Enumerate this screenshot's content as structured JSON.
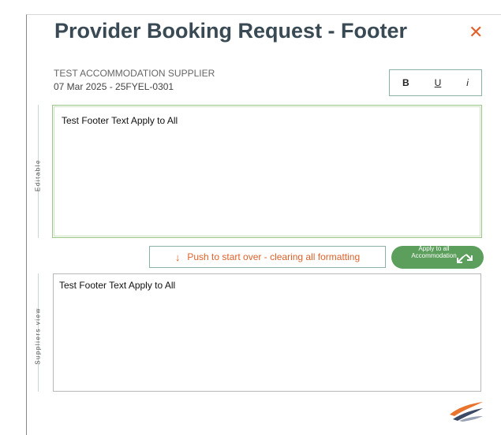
{
  "dialog": {
    "title": "Provider Booking Request - Footer",
    "close_symbol": "✕",
    "supplier_name": "TEST ACCOMMODATION SUPPLIER",
    "booking_ref": "07 Mar 2025 - 25FYEL-0301"
  },
  "toolbar": {
    "bold_label": "B",
    "underline_label": "U",
    "italic_label": "i"
  },
  "editor": {
    "side_label": "Editable",
    "content": "Test Footer Text Apply to All"
  },
  "actions": {
    "push_icon": "↓",
    "push_label": "Push to start over - clearing all formatting",
    "apply_label": "Apply to all Accommodation",
    "apply_icon": "expand-arrows-icon"
  },
  "preview": {
    "side_label": "Suppliers view",
    "content": "Test Footer Text Apply to All"
  },
  "colors": {
    "accent_orange": "#e0612a",
    "apply_green": "#5c9e5c",
    "title_color": "#3a4a54",
    "border_teal": "#8bb1a8"
  },
  "logo": {
    "icon": "brand-swoosh-logo"
  }
}
